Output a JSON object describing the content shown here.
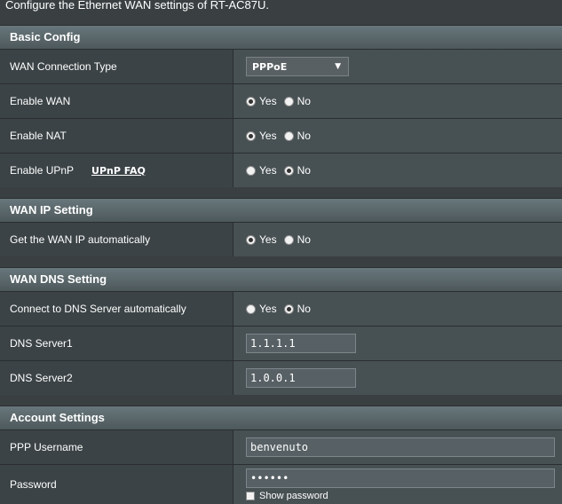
{
  "intro": "Configure the Ethernet WAN settings of RT-AC87U.",
  "radio": {
    "yes": "Yes",
    "no": "No"
  },
  "basic": {
    "title": "Basic Config",
    "wan_type_label": "WAN Connection Type",
    "wan_type_value": "PPPoE",
    "enable_wan_label": "Enable WAN",
    "enable_wan_value": "Yes",
    "enable_nat_label": "Enable NAT",
    "enable_nat_value": "Yes",
    "enable_upnp_label": "Enable UPnP",
    "upnp_faq": "UPnP FAQ",
    "enable_upnp_value": "No"
  },
  "wan_ip": {
    "title": "WAN IP Setting",
    "auto_ip_label": "Get the WAN IP automatically",
    "auto_ip_value": "Yes"
  },
  "wan_dns": {
    "title": "WAN DNS Setting",
    "auto_dns_label": "Connect to DNS Server automatically",
    "auto_dns_value": "No",
    "dns1_label": "DNS Server1",
    "dns1_value": "1.1.1.1",
    "dns2_label": "DNS Server2",
    "dns2_value": "1.0.0.1"
  },
  "account": {
    "title": "Account Settings",
    "username_label": "PPP Username",
    "username_value": "benvenuto",
    "password_label": "Password",
    "password_value": "••••••",
    "show_password_label": "Show password"
  },
  "colors": {
    "background": "#3a4042",
    "section_header": "#5f6d72",
    "label_cell": "#3b4346",
    "value_cell": "#475053"
  }
}
